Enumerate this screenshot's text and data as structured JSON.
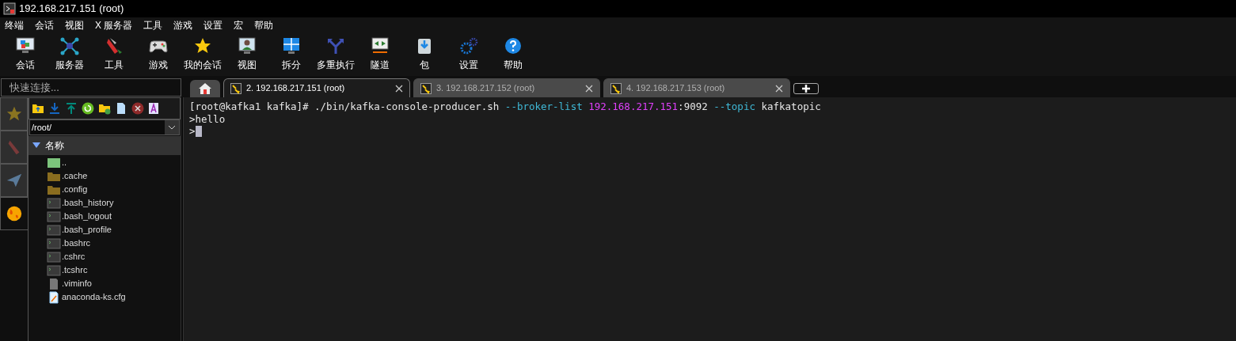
{
  "window": {
    "title": "192.168.217.151 (root)"
  },
  "menu": [
    "终端",
    "会话",
    "视图",
    "X 服务器",
    "工具",
    "游戏",
    "设置",
    "宏",
    "帮助"
  ],
  "toolbar": [
    {
      "label": "会话"
    },
    {
      "label": "服务器"
    },
    {
      "label": "工具"
    },
    {
      "label": "游戏"
    },
    {
      "label": "我的会话"
    },
    {
      "label": "视图"
    },
    {
      "label": "拆分"
    },
    {
      "label": "多重执行"
    },
    {
      "label": "隧道"
    },
    {
      "label": "包"
    },
    {
      "label": "设置"
    },
    {
      "label": "帮助"
    }
  ],
  "quick_connect": {
    "placeholder": "快速连接..."
  },
  "side_tabs": [
    {
      "selected": false
    },
    {
      "selected": false
    },
    {
      "selected": false
    },
    {
      "selected": true
    }
  ],
  "file_panel": {
    "path": "/root/",
    "column": "名称",
    "files": [
      {
        "name": "..",
        "kind": "parent"
      },
      {
        "name": ".cache",
        "kind": "folder"
      },
      {
        "name": ".config",
        "kind": "folder"
      },
      {
        "name": ".bash_history",
        "kind": "script"
      },
      {
        "name": ".bash_logout",
        "kind": "script"
      },
      {
        "name": ".bash_profile",
        "kind": "script"
      },
      {
        "name": ".bashrc",
        "kind": "script"
      },
      {
        "name": ".cshrc",
        "kind": "script"
      },
      {
        "name": ".tcshrc",
        "kind": "script"
      },
      {
        "name": ".viminfo",
        "kind": "file"
      },
      {
        "name": "anaconda-ks.cfg",
        "kind": "text"
      }
    ]
  },
  "tabs": [
    {
      "label": "2. 192.168.217.151 (root)",
      "selected": true
    },
    {
      "label": "3. 192.168.217.152 (root)",
      "selected": false
    },
    {
      "label": "4. 192.168.217.153 (root)",
      "selected": false
    }
  ],
  "terminal": {
    "lines": [
      {
        "segments": [
          {
            "text": "[root@kafka1 kafka]# ./bin/kafka-console-producer.sh ",
            "kind": "plain"
          },
          {
            "text": "--broker-list ",
            "kind": "option"
          },
          {
            "text": "192.168.217.151",
            "kind": "ip"
          },
          {
            "text": ":9092 ",
            "kind": "plain"
          },
          {
            "text": "--topic",
            "kind": "option"
          },
          {
            "text": " kafkatopic",
            "kind": "plain"
          }
        ]
      },
      {
        "segments": [
          {
            "text": ">hello",
            "kind": "plain"
          }
        ]
      },
      {
        "segments": [
          {
            "text": ">",
            "kind": "plain"
          }
        ],
        "cursor": true
      }
    ]
  }
}
